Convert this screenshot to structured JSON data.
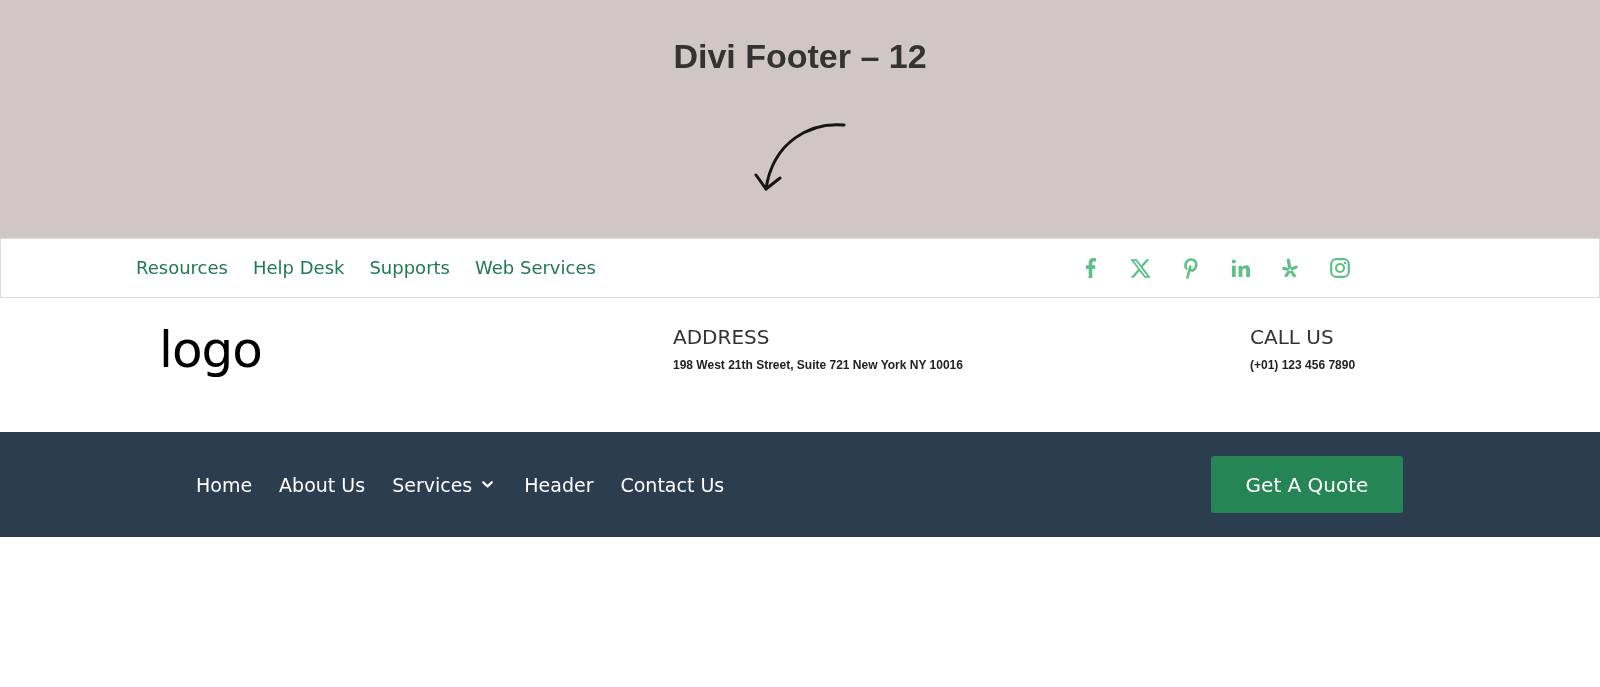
{
  "banner": {
    "title": "Divi Footer – 12"
  },
  "top_bar": {
    "links": [
      "Resources",
      "Help Desk",
      "Supports",
      "Web Services"
    ]
  },
  "info": {
    "logo": "logo",
    "columns": [
      {
        "heading": "ADDRESS",
        "text": "198 West 21th Street, Suite 721 New York NY 10016"
      },
      {
        "heading": "CALL US",
        "text": "(+01) 123 456 7890"
      }
    ]
  },
  "main_nav": {
    "items": [
      {
        "label": "Home",
        "has_submenu": false
      },
      {
        "label": "About Us",
        "has_submenu": false
      },
      {
        "label": "Services",
        "has_submenu": true
      },
      {
        "label": "Header",
        "has_submenu": false
      },
      {
        "label": "Contact Us",
        "has_submenu": false
      }
    ],
    "button": "Get A Quote"
  }
}
